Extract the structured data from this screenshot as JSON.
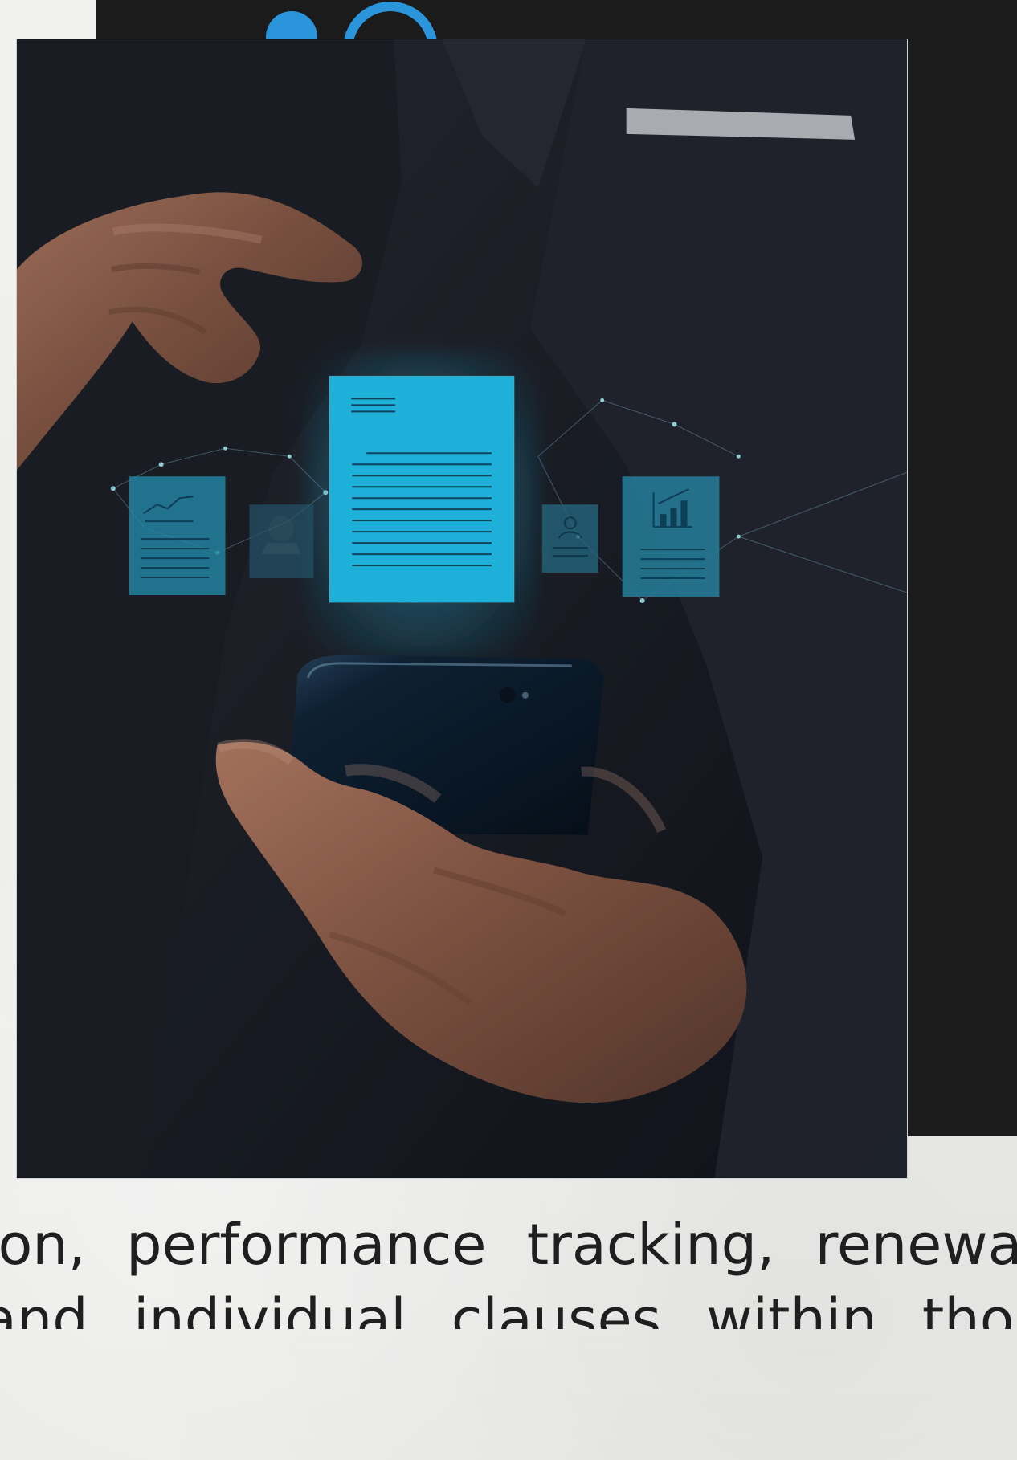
{
  "caption": {
    "line1": "ion, performance tracking, renewal,",
    "line2": "and individual clauses within those"
  },
  "colors": {
    "background": "#ededeb",
    "dark_block": "#1b1b1b",
    "accent_blue": "#2b95db",
    "hologram_primary": "#1ec7f6",
    "hologram_secondary": "#2596b8",
    "caption_text": "#1f1f1f"
  },
  "icons": {
    "decorative_circle": "filled-circle-icon",
    "decorative_ring": "ring-icon",
    "central_document": "document-icon",
    "left_chart_card": "line-chart-card-icon",
    "left_small_card": "folder-icon",
    "right_profile_card": "profile-card-icon",
    "right_bar_chart_card": "bar-chart-card-icon"
  }
}
